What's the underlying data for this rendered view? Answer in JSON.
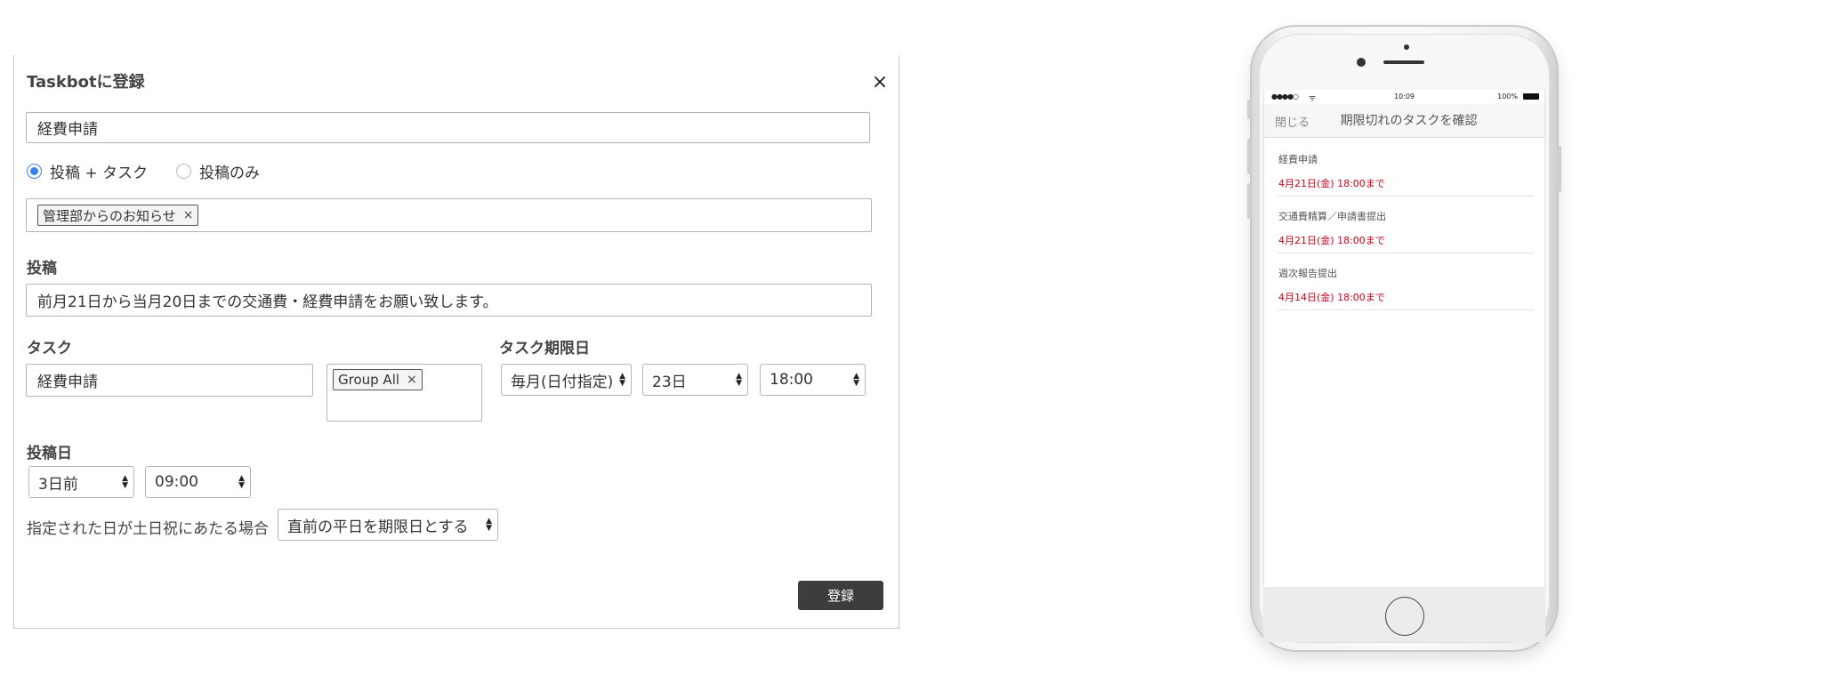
{
  "dialog": {
    "title": "Taskbotに登録",
    "close_label": "×",
    "task_title_value": "経費申請",
    "radio_options": [
      {
        "label": "投稿 + タスク",
        "checked": true
      },
      {
        "label": "投稿のみ",
        "checked": false
      }
    ],
    "channel_tag": "管理部からのお知らせ",
    "tag_remove": "×",
    "post_label": "投稿",
    "post_value": "前月21日から当月20日までの交通費・経費申請をお願い致します。",
    "task_label": "タスク",
    "task_value": "経費申請",
    "assignee_tag": "Group All",
    "deadline_label": "タスク期限日",
    "deadline_type": "毎月(日付指定)",
    "deadline_day": "23日",
    "deadline_time": "18:00",
    "post_date_label": "投稿日",
    "post_days_before": "3日前",
    "post_time": "09:00",
    "holiday_text": "指定された日が土日祝にあたる場合",
    "holiday_option": "直前の平日を期限日とする",
    "submit_label": "登録"
  },
  "phone": {
    "status": {
      "signal": "●●●●○",
      "wifi": "ᯤ",
      "time": "10:09",
      "battery": "100%"
    },
    "nav_close": "閉じる",
    "nav_title": "期限切れのタスクを確認",
    "tasks": [
      {
        "name": "経費申請",
        "due": "4月21日(金) 18:00まで"
      },
      {
        "name": "交通費精算／申請書提出",
        "due": "4月21日(金) 18:00まで"
      },
      {
        "name": "週次報告提出",
        "due": "4月14日(金) 18:00まで"
      }
    ],
    "due_color": "#d0021b"
  }
}
